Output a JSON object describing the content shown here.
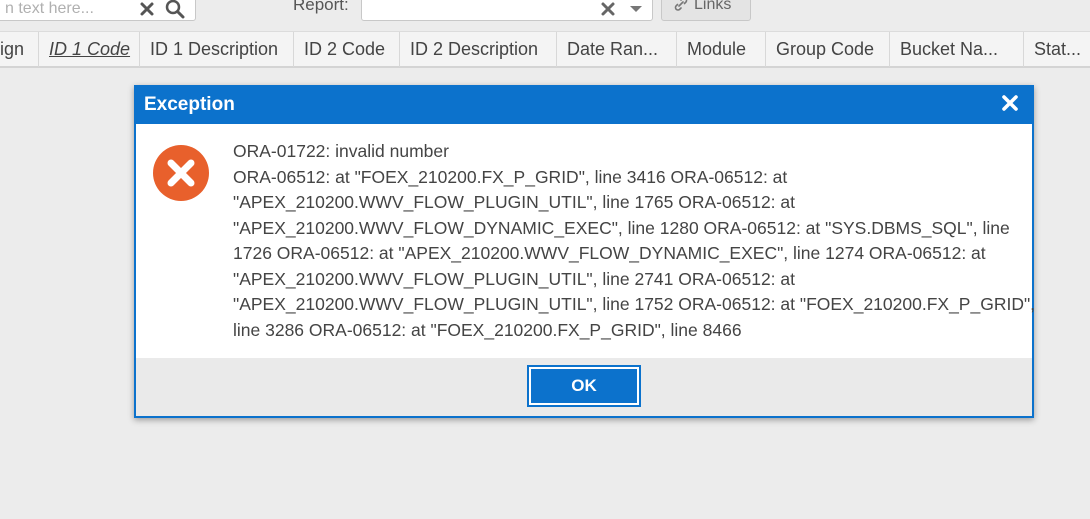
{
  "toolbar": {
    "search_placeholder": "n text here...",
    "report_label": "Report:",
    "links_label": "Links"
  },
  "grid": {
    "columns": [
      "ign",
      "ID 1 Code",
      "ID 1 Description",
      "ID 2 Code",
      "ID 2 Description",
      "Date Ran...",
      "Module",
      "Group Code",
      "Bucket Na...",
      "Stat..."
    ]
  },
  "dialog": {
    "title": "Exception",
    "message_lines": [
      "ORA-01722: invalid number",
      "ORA-06512: at \"FOEX_210200.FX_P_GRID\", line 3416 ORA-06512: at",
      "\"APEX_210200.WWV_FLOW_PLUGIN_UTIL\", line 1765 ORA-06512: at",
      "\"APEX_210200.WWV_FLOW_DYNAMIC_EXEC\", line 1280 ORA-06512: at \"SYS.DBMS_SQL\", line",
      "1726 ORA-06512: at \"APEX_210200.WWV_FLOW_DYNAMIC_EXEC\", line 1274 ORA-06512: at",
      "\"APEX_210200.WWV_FLOW_PLUGIN_UTIL\", line 2741 ORA-06512: at",
      "\"APEX_210200.WWV_FLOW_PLUGIN_UTIL\", line 1752 ORA-06512: at \"FOEX_210200.FX_P_GRID\",",
      "line 3286 ORA-06512: at \"FOEX_210200.FX_P_GRID\", line 8466"
    ],
    "ok_label": "OK",
    "icons": {
      "error": "error-circle-x-icon",
      "close": "close-icon"
    }
  },
  "colors": {
    "accent": "#0c72cc",
    "error": "#e8602c",
    "background": "#ececec"
  }
}
